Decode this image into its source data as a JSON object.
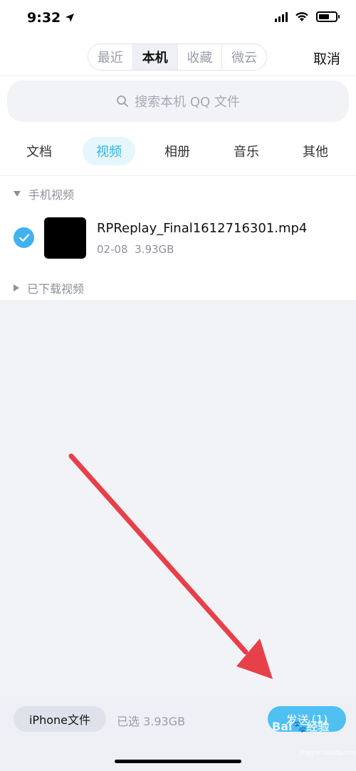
{
  "status_bar": {
    "time": "9:32"
  },
  "header": {
    "segments": [
      {
        "label": "最近",
        "active": false
      },
      {
        "label": "本机",
        "active": true
      },
      {
        "label": "收藏",
        "active": false
      },
      {
        "label": "微云",
        "active": false
      }
    ],
    "cancel_label": "取消"
  },
  "search": {
    "placeholder": "搜索本机 QQ 文件",
    "icon": "search-icon"
  },
  "tabs": [
    {
      "label": "文档",
      "active": false
    },
    {
      "label": "视频",
      "active": true
    },
    {
      "label": "相册",
      "active": false
    },
    {
      "label": "音乐",
      "active": false
    },
    {
      "label": "其他",
      "active": false
    }
  ],
  "sections": {
    "phone_videos": {
      "title": "手机视频",
      "expanded": true,
      "files": [
        {
          "name": "RPReplay_Final1612716301.mp4",
          "date": "02-08",
          "size": "3.93GB",
          "selected": true
        }
      ]
    },
    "downloaded_videos": {
      "title": "已下载视频",
      "expanded": false
    }
  },
  "bottom_bar": {
    "iphone_files_label": "iPhone文件",
    "selected_info": "已选 3.93GB",
    "send_label": "发送",
    "send_count": "(1)"
  },
  "colors": {
    "accent": "#2fb3e8",
    "send_button": "#4fc0f2",
    "checkbox": "#3fb2ef",
    "annotation_arrow": "#e8404a"
  },
  "watermark": {
    "text": "Bai🐾经验",
    "sub": "jingyan.baidu.com"
  }
}
